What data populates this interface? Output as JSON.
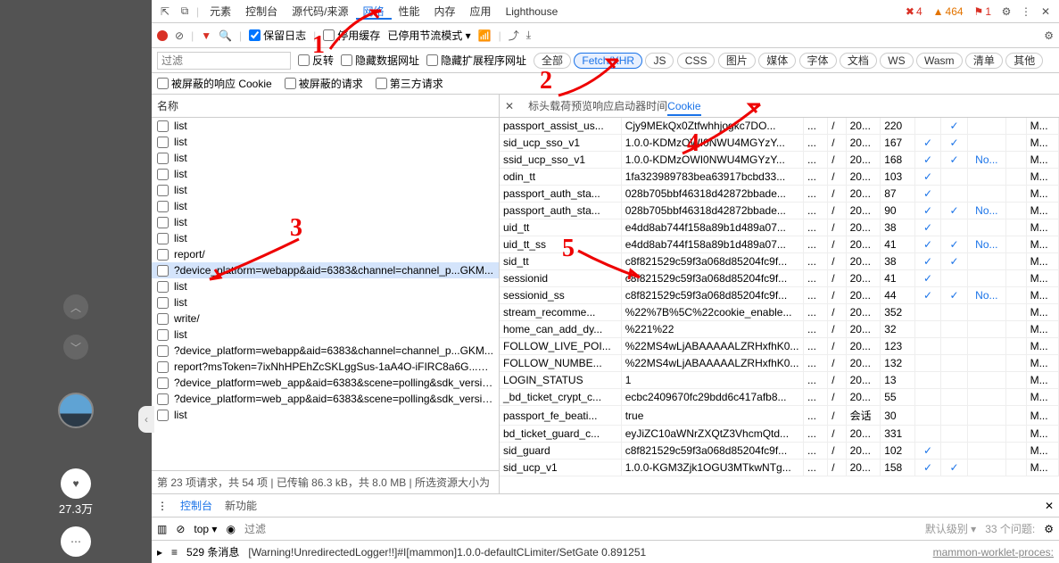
{
  "likes": "27.3万",
  "mainTabs": [
    "元素",
    "控制台",
    "源代码/来源",
    "网络",
    "性能",
    "内存",
    "应用",
    "Lighthouse"
  ],
  "mainTabActive": 3,
  "badges": {
    "err": "4",
    "warn": "464",
    "inf": "1"
  },
  "toolbar": {
    "keepLog": "保留日志",
    "disableCache": "停用缓存",
    "throttling": "已停用节流模式"
  },
  "filterInputPlaceholder": "过滤",
  "cbInvert": "反转",
  "cbHideData": "隐藏数据网址",
  "cbHideExt": "隐藏扩展程序网址",
  "pills": [
    "全部",
    "Fetch/XHR",
    "JS",
    "CSS",
    "图片",
    "媒体",
    "字体",
    "文档",
    "WS",
    "Wasm",
    "清单",
    "其他"
  ],
  "pillSelected": 1,
  "sub": {
    "blockedCookie": "被屏蔽的响应 Cookie",
    "blockedReq": "被屏蔽的请求",
    "thirdParty": "第三方请求"
  },
  "colHdr": "名称",
  "rows": [
    "list",
    "list",
    "list",
    "list",
    "list",
    "list",
    "list",
    "list",
    "report/",
    "?device_platform=webapp&aid=6383&channel=channel_p...GKM...",
    "list",
    "list",
    "write/",
    "list",
    "?device_platform=webapp&aid=6383&channel=channel_p...GKM...",
    "report?msToken=7ixNhHPEhZcSKLggSus-1aA4O-iFIRC8a6G...GKM...",
    "?device_platform=web_app&aid=6383&scene=polling&sdk_versio...",
    "?device_platform=web_app&aid=6383&scene=polling&sdk_versio...",
    "list"
  ],
  "rowSelected": 9,
  "statusLine": "第 23 项请求，共 54 项  |  已传输 86.3 kB，共 8.0 MB  |  所选资源大小为",
  "tabs2": [
    "标头",
    "载荷",
    "预览",
    "响应",
    "启动器",
    "时间",
    "Cookie"
  ],
  "tabs2Active": 6,
  "cookies": [
    {
      "n": "passport_assist_us...",
      "v": "Cjy9MEkQx0Ztfwhhjogkc7DO...",
      "d": "...",
      "p": "/",
      "e": "20...",
      "s": "220",
      "h": "",
      "sc": "✓",
      "ss": "",
      "pt": "",
      "pr": "M..."
    },
    {
      "n": "sid_ucp_sso_v1",
      "v": "1.0.0-KDMzOWI0NWU4MGYzY...",
      "d": "...",
      "p": "/",
      "e": "20...",
      "s": "167",
      "h": "✓",
      "sc": "✓",
      "ss": "",
      "pt": "",
      "pr": "M..."
    },
    {
      "n": "ssid_ucp_sso_v1",
      "v": "1.0.0-KDMzOWI0NWU4MGYzY...",
      "d": "...",
      "p": "/",
      "e": "20...",
      "s": "168",
      "h": "✓",
      "sc": "✓",
      "ss": "No...",
      "pt": "",
      "pr": "M..."
    },
    {
      "n": "odin_tt",
      "v": "1fa323989783bea63917bcbd33...",
      "d": "...",
      "p": "/",
      "e": "20...",
      "s": "103",
      "h": "✓",
      "sc": "",
      "ss": "",
      "pt": "",
      "pr": "M..."
    },
    {
      "n": "passport_auth_sta...",
      "v": "028b705bbf46318d42872bbade...",
      "d": "...",
      "p": "/",
      "e": "20...",
      "s": "87",
      "h": "✓",
      "sc": "",
      "ss": "",
      "pt": "",
      "pr": "M..."
    },
    {
      "n": "passport_auth_sta...",
      "v": "028b705bbf46318d42872bbade...",
      "d": "...",
      "p": "/",
      "e": "20...",
      "s": "90",
      "h": "✓",
      "sc": "✓",
      "ss": "No...",
      "pt": "",
      "pr": "M..."
    },
    {
      "n": "uid_tt",
      "v": "e4dd8ab744f158a89b1d489a07...",
      "d": "...",
      "p": "/",
      "e": "20...",
      "s": "38",
      "h": "✓",
      "sc": "",
      "ss": "",
      "pt": "",
      "pr": "M..."
    },
    {
      "n": "uid_tt_ss",
      "v": "e4dd8ab744f158a89b1d489a07...",
      "d": "...",
      "p": "/",
      "e": "20...",
      "s": "41",
      "h": "✓",
      "sc": "✓",
      "ss": "No...",
      "pt": "",
      "pr": "M..."
    },
    {
      "n": "sid_tt",
      "v": "c8f821529c59f3a068d85204fc9f...",
      "d": "...",
      "p": "/",
      "e": "20...",
      "s": "38",
      "h": "✓",
      "sc": "✓",
      "ss": "",
      "pt": "",
      "pr": "M..."
    },
    {
      "n": "sessionid",
      "v": "c8f821529c59f3a068d85204fc9f...",
      "d": "...",
      "p": "/",
      "e": "20...",
      "s": "41",
      "h": "✓",
      "sc": "",
      "ss": "",
      "pt": "",
      "pr": "M..."
    },
    {
      "n": "sessionid_ss",
      "v": "c8f821529c59f3a068d85204fc9f...",
      "d": "...",
      "p": "/",
      "e": "20...",
      "s": "44",
      "h": "✓",
      "sc": "✓",
      "ss": "No...",
      "pt": "",
      "pr": "M..."
    },
    {
      "n": "stream_recomme...",
      "v": "%22%7B%5C%22cookie_enable...",
      "d": "...",
      "p": "/",
      "e": "20...",
      "s": "352",
      "h": "",
      "sc": "",
      "ss": "",
      "pt": "",
      "pr": "M..."
    },
    {
      "n": "home_can_add_dy...",
      "v": "%221%22",
      "d": "...",
      "p": "/",
      "e": "20...",
      "s": "32",
      "h": "",
      "sc": "",
      "ss": "",
      "pt": "",
      "pr": "M..."
    },
    {
      "n": "FOLLOW_LIVE_POI...",
      "v": "%22MS4wLjABAAAAALZRHxfhK0...",
      "d": "...",
      "p": "/",
      "e": "20...",
      "s": "123",
      "h": "",
      "sc": "",
      "ss": "",
      "pt": "",
      "pr": "M..."
    },
    {
      "n": "FOLLOW_NUMBE...",
      "v": "%22MS4wLjABAAAAALZRHxfhK0...",
      "d": "...",
      "p": "/",
      "e": "20...",
      "s": "132",
      "h": "",
      "sc": "",
      "ss": "",
      "pt": "",
      "pr": "M..."
    },
    {
      "n": "LOGIN_STATUS",
      "v": "1",
      "d": "...",
      "p": "/",
      "e": "20...",
      "s": "13",
      "h": "",
      "sc": "",
      "ss": "",
      "pt": "",
      "pr": "M..."
    },
    {
      "n": "_bd_ticket_crypt_c...",
      "v": "ecbc2409670fc29bdd6c417afb8...",
      "d": "...",
      "p": "/",
      "e": "20...",
      "s": "55",
      "h": "",
      "sc": "",
      "ss": "",
      "pt": "",
      "pr": "M..."
    },
    {
      "n": "passport_fe_beati...",
      "v": "true",
      "d": "...",
      "p": "/",
      "e": "会话",
      "s": "30",
      "h": "",
      "sc": "",
      "ss": "",
      "pt": "",
      "pr": "M..."
    },
    {
      "n": "bd_ticket_guard_c...",
      "v": "eyJiZC10aWNrZXQtZ3VhcmQtd...",
      "d": "...",
      "p": "/",
      "e": "20...",
      "s": "331",
      "h": "",
      "sc": "",
      "ss": "",
      "pt": "",
      "pr": "M..."
    },
    {
      "n": "sid_guard",
      "v": "c8f821529c59f3a068d85204fc9f...",
      "d": "...",
      "p": "/",
      "e": "20...",
      "s": "102",
      "h": "✓",
      "sc": "",
      "ss": "",
      "pt": "",
      "pr": "M..."
    },
    {
      "n": "sid_ucp_v1",
      "v": "1.0.0-KGM3Zjk1OGU3MTkwNTg...",
      "d": "...",
      "p": "/",
      "e": "20...",
      "s": "158",
      "h": "✓",
      "sc": "✓",
      "ss": "",
      "pt": "",
      "pr": "M..."
    }
  ],
  "botTabs": {
    "console": "控制台",
    "newfeat": "新功能"
  },
  "consoleTop": "top",
  "consoleFilter": "过滤",
  "consoleLevel": "默认级别",
  "consoleProblems": "33 个问题:",
  "msgCount": "529 条消息",
  "msgText": "[Warning!UnredirectedLogger!!]#I[mammon]1.0.0-defaultCLimiter/SetGate 0.891251",
  "msgSrc": "mammon-worklet-proces:",
  "marks": {
    "m1": "1",
    "m2": "2",
    "m3": "3",
    "m4": "4",
    "m5": "5"
  }
}
